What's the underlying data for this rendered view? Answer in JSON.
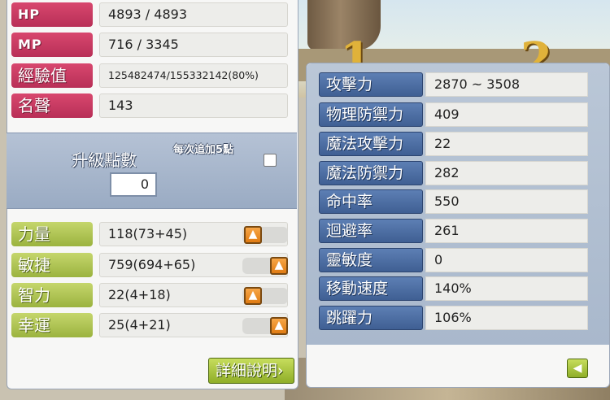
{
  "basic": [
    {
      "label": "HP",
      "value": "4893 / 4893"
    },
    {
      "label": "MP",
      "value": "716 / 3345"
    },
    {
      "label": "經驗值",
      "value": "125482474/155332142(80%)"
    },
    {
      "label": "名聲",
      "value": "143"
    }
  ],
  "ap": {
    "title": "升級點數",
    "value": "0",
    "toggle_label": "每次追加5點",
    "toggle_checked": false
  },
  "stats": [
    {
      "label": "力量",
      "value": "118(73+45)"
    },
    {
      "label": "敏捷",
      "value": "759(694+65)"
    },
    {
      "label": "智力",
      "value": "22(4+18)"
    },
    {
      "label": "幸運",
      "value": "25(4+21)"
    }
  ],
  "detail_button": "詳細說明",
  "attributes": [
    {
      "label": "攻擊力",
      "value": "2870 ~ 3508"
    },
    {
      "label": "物理防禦力",
      "value": "409"
    },
    {
      "label": "魔法攻擊力",
      "value": "22"
    },
    {
      "label": "魔法防禦力",
      "value": "282"
    },
    {
      "label": "命中率",
      "value": "550"
    },
    {
      "label": "迴避率",
      "value": "261"
    },
    {
      "label": "靈敏度",
      "value": "0"
    },
    {
      "label": "移動速度",
      "value": "140%"
    },
    {
      "label": "跳躍力",
      "value": "106%"
    }
  ],
  "icons": {
    "plus": "arrow-up-icon",
    "back": "arrow-left-icon"
  },
  "colors": {
    "basic_label": "#c93a62",
    "stat_label": "#a9c24a",
    "attr_label": "#4e6fa3",
    "plus_button": "#ee8c22"
  }
}
